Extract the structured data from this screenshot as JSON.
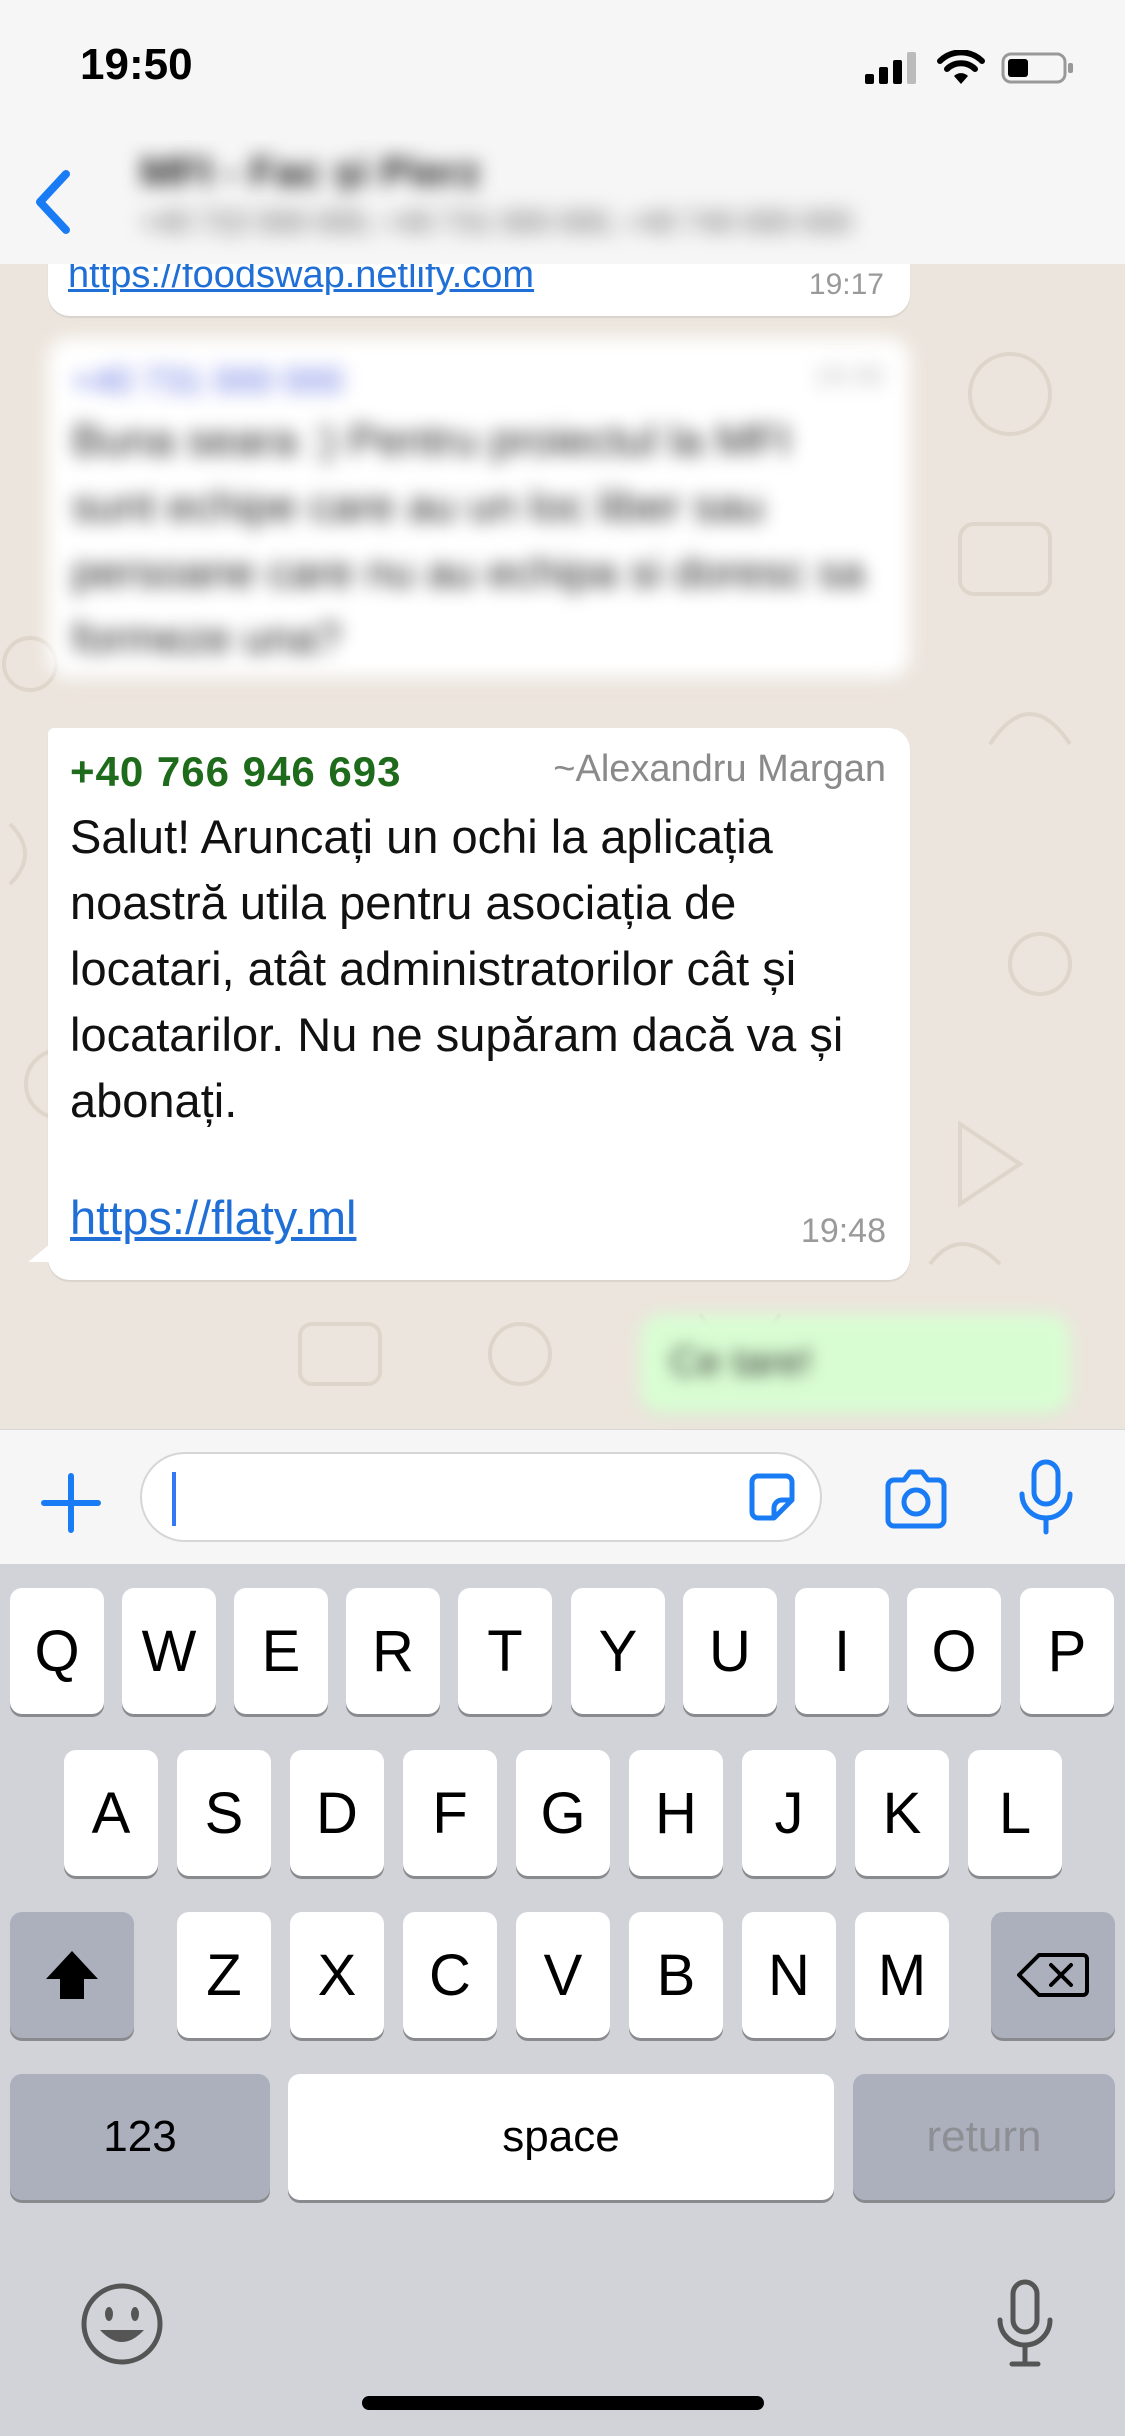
{
  "status_bar": {
    "time": "19:50",
    "icons": [
      "signal-icon",
      "wifi-icon",
      "battery-icon"
    ]
  },
  "header": {
    "back_icon": "chevron-left-icon",
    "title": "MFI - Fac și Pierz",
    "subtitle": "+40 722 000 000, +40 731 000 000, +40 740 000 000"
  },
  "messages": [
    {
      "link": "https://foodswap.netlify.com",
      "time": "19:17"
    },
    {
      "sender": "+40 731 000 000",
      "text": "Buna seara :) Pentru proiectul la MFI sunt echipe care au un loc liber sau persoane care nu au echipa si doresc sa formeze una?",
      "time": "19:30"
    },
    {
      "sender": "+40 766 946 693",
      "sender_name": "~Alexandru Margan",
      "text": "Salut! Aruncați un ochi la aplicația noastră utila pentru asociația de locatari, atât administratorilor cât și locatarilor. Nu ne supăram dacă va și abonați.",
      "link": "https://flaty.ml",
      "time": "19:48"
    },
    {
      "text": "Ce tare!",
      "outgoing": true
    }
  ],
  "composer": {
    "value": "",
    "icons": [
      "plus-icon",
      "sticker-icon",
      "camera-icon",
      "microphone-icon"
    ]
  },
  "keyboard": {
    "row1": [
      "Q",
      "W",
      "E",
      "R",
      "T",
      "Y",
      "U",
      "I",
      "O",
      "P"
    ],
    "row2": [
      "A",
      "S",
      "D",
      "F",
      "G",
      "H",
      "J",
      "K",
      "L"
    ],
    "row3": [
      "Z",
      "X",
      "C",
      "V",
      "B",
      "N",
      "M"
    ],
    "numbers_label": "123",
    "space_label": "space",
    "return_label": "return",
    "icons": [
      "shift-icon",
      "backspace-icon",
      "emoji-icon",
      "dictation-icon"
    ]
  },
  "colors": {
    "link": "#1f6fd6",
    "sender_green": "#1f6b1c",
    "ios_blue": "#3478f6",
    "outgoing_bubble": "#d9fdd3"
  }
}
